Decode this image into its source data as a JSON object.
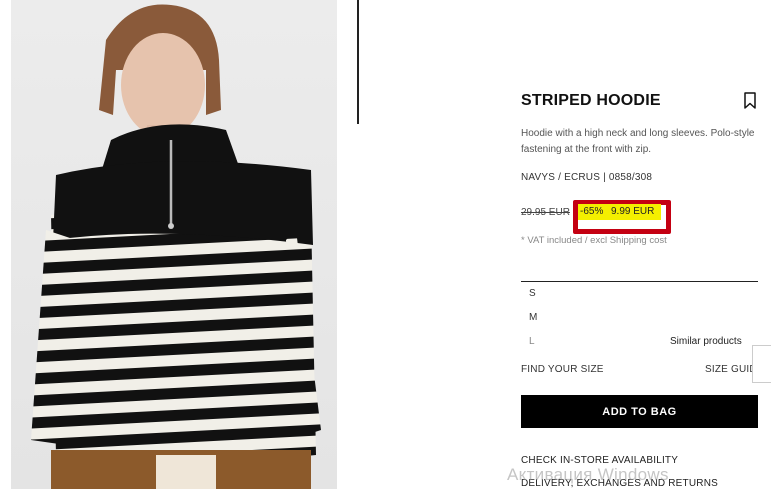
{
  "product": {
    "title": "STRIPED HOODIE",
    "description": "Hoodie with a high neck and long sleeves. Polo-style fastening at the front with zip.",
    "color_code": "NAVYS / ECRUS | 0858/308",
    "image_alt": "Model wearing striped hoodie"
  },
  "price": {
    "old": "29.95 EUR",
    "discount": "-65%",
    "new": "9.99 EUR",
    "vat_note": "* VAT included / excl Shipping cost"
  },
  "sizes": [
    "S",
    "M",
    "L"
  ],
  "similar_products_label": "Similar products",
  "find_your_size": "FIND YOUR SIZE",
  "size_guide": "SIZE GUIDE",
  "add_to_bag": "ADD TO BAG",
  "links": [
    "CHECK IN-STORE AVAILABILITY",
    "DELIVERY, EXCHANGES AND RETURNS"
  ],
  "watermark": "Активация Windows",
  "colors": {
    "highlight": "#f4ef00",
    "annotation_border": "#c40012",
    "button_bg": "#000000"
  },
  "icons": {
    "bookmark": "bookmark-icon"
  }
}
